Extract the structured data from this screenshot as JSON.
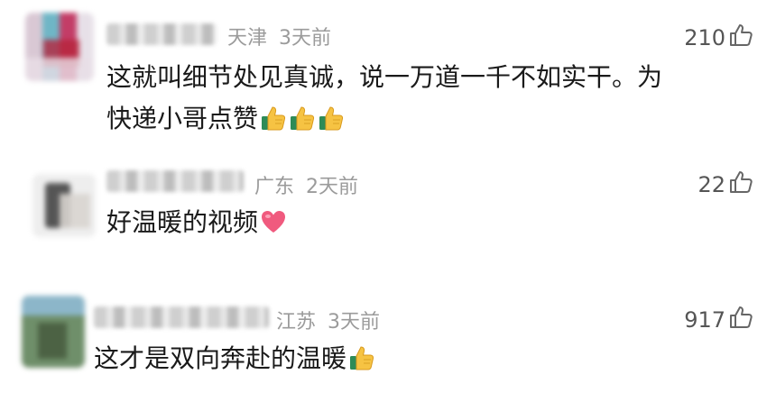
{
  "comments": [
    {
      "location": "天津",
      "time": "3天前",
      "likes": "210",
      "text_line1": "这就叫细节处见真诚，说一万道一千不如实干。为",
      "text_line2": "快递小哥点赞",
      "emojis": [
        "thumbs-up",
        "thumbs-up",
        "thumbs-up"
      ]
    },
    {
      "location": "广东",
      "time": "2天前",
      "likes": "22",
      "text_line1": "好温暖的视频",
      "emojis": [
        "heart"
      ]
    },
    {
      "location": "江苏",
      "time": "3天前",
      "likes": "917",
      "text_line1": "这才是双向奔赴的温暖",
      "emojis": [
        "thumbs-up"
      ]
    }
  ],
  "colors": {
    "meta_gray": "#9b9b9b",
    "text": "#1a1a1a",
    "thumb_yellow": "#f6c343",
    "heart_pink": "#f05a7e"
  }
}
